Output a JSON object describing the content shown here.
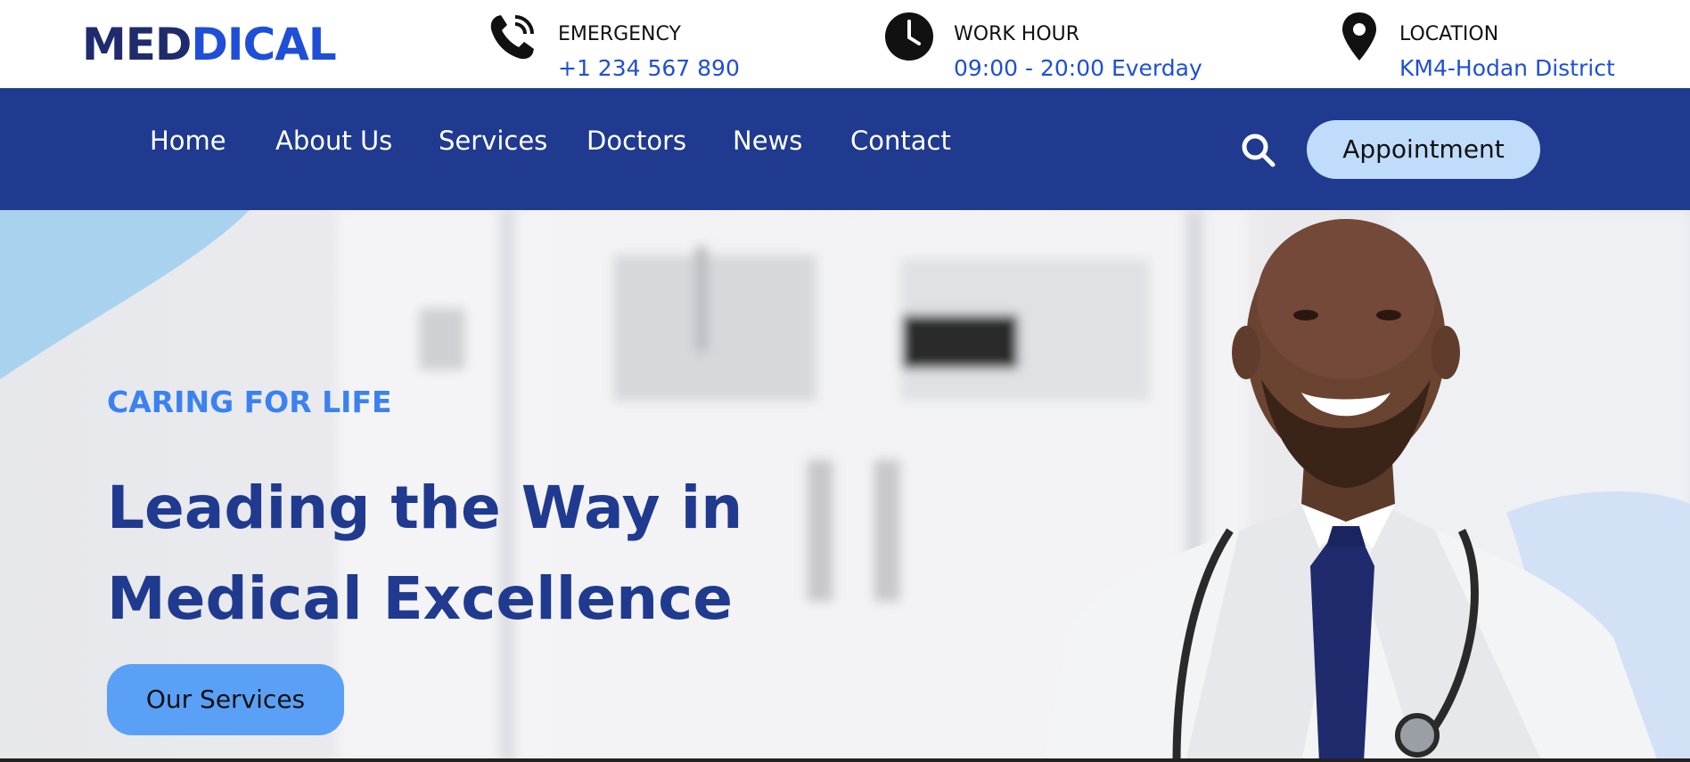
{
  "brand": {
    "logo_part1": "MED",
    "logo_part2": "DICAL"
  },
  "info": {
    "emergency": {
      "icon": "phone-call-icon",
      "label": "EMERGENCY",
      "value": "+1 234 567 890"
    },
    "work_hour": {
      "icon": "clock-icon",
      "label": "WORK HOUR",
      "value": "09:00 - 20:00 Everday"
    },
    "location": {
      "icon": "map-pin-icon",
      "label": "LOCATION",
      "value": "KM4-Hodan District"
    }
  },
  "nav": {
    "items": [
      {
        "label": "Home"
      },
      {
        "label": "About Us"
      },
      {
        "label": "Services"
      },
      {
        "label": "Doctors"
      },
      {
        "label": "News"
      },
      {
        "label": "Contact"
      }
    ],
    "search_icon": "search-icon",
    "appointment_label": "Appointment"
  },
  "hero": {
    "tagline": "CARING FOR LIFE",
    "headline_line1": "Leading the Way in",
    "headline_line2": "Medical Excellence",
    "cta_label": "Our Services"
  },
  "colors": {
    "brand_dark": "#1f2b6c",
    "brand_blue": "#1f4fd6",
    "nav_bg": "#1f3a8f",
    "accent_light": "#bfdcfb",
    "tagline": "#3b82f0",
    "cta_bg": "#5aa0f6"
  }
}
